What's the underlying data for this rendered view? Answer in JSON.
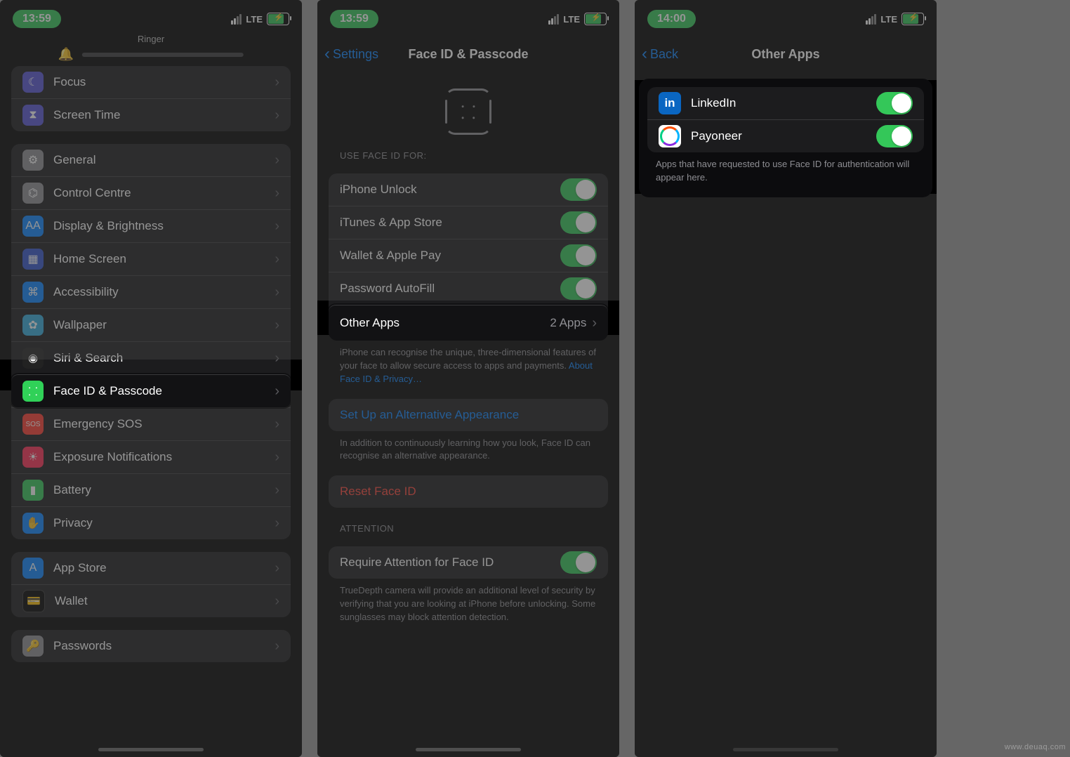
{
  "screens": {
    "s1": {
      "time": "13:59",
      "net": "LTE",
      "ringer_label": "Ringer",
      "items": {
        "focus": "Focus",
        "screentime": "Screen Time",
        "general": "General",
        "control": "Control Centre",
        "display": "Display & Brightness",
        "home": "Home Screen",
        "access": "Accessibility",
        "wallpaper": "Wallpaper",
        "siri": "Siri & Search",
        "faceid": "Face ID & Passcode",
        "sos": "Emergency SOS",
        "exposure": "Exposure Notifications",
        "battery": "Battery",
        "privacy": "Privacy",
        "appstore": "App Store",
        "wallet": "Wallet",
        "passwords": "Passwords"
      }
    },
    "s2": {
      "time": "13:59",
      "net": "LTE",
      "back": "Settings",
      "title": "Face ID & Passcode",
      "use_header": "Use Face ID For:",
      "rows": {
        "unlock": "iPhone Unlock",
        "itunes": "iTunes & App Store",
        "wallet": "Wallet & Apple Pay",
        "autofill": "Password AutoFill",
        "other": "Other Apps",
        "other_detail": "2 Apps"
      },
      "footer1a": "iPhone can recognise the unique, three-dimensional features of your face to allow secure access to apps and payments. ",
      "footer1b": "About Face ID & Privacy…",
      "alt": "Set Up an Alternative Appearance",
      "footer2": "In addition to continuously learning how you look, Face ID can recognise an alternative appearance.",
      "reset": "Reset Face ID",
      "att_header": "Attention",
      "att_row": "Require Attention for Face ID",
      "footer3": "TrueDepth camera will provide an additional level of security by verifying that you are looking at iPhone before unlocking. Some sunglasses may block attention detection."
    },
    "s3": {
      "time": "14:00",
      "net": "LTE",
      "back": "Back",
      "title": "Other Apps",
      "apps": {
        "linkedin": "LinkedIn",
        "payoneer": "Payoneer"
      },
      "footer": "Apps that have requested to use Face ID for authentication will appear here."
    }
  }
}
